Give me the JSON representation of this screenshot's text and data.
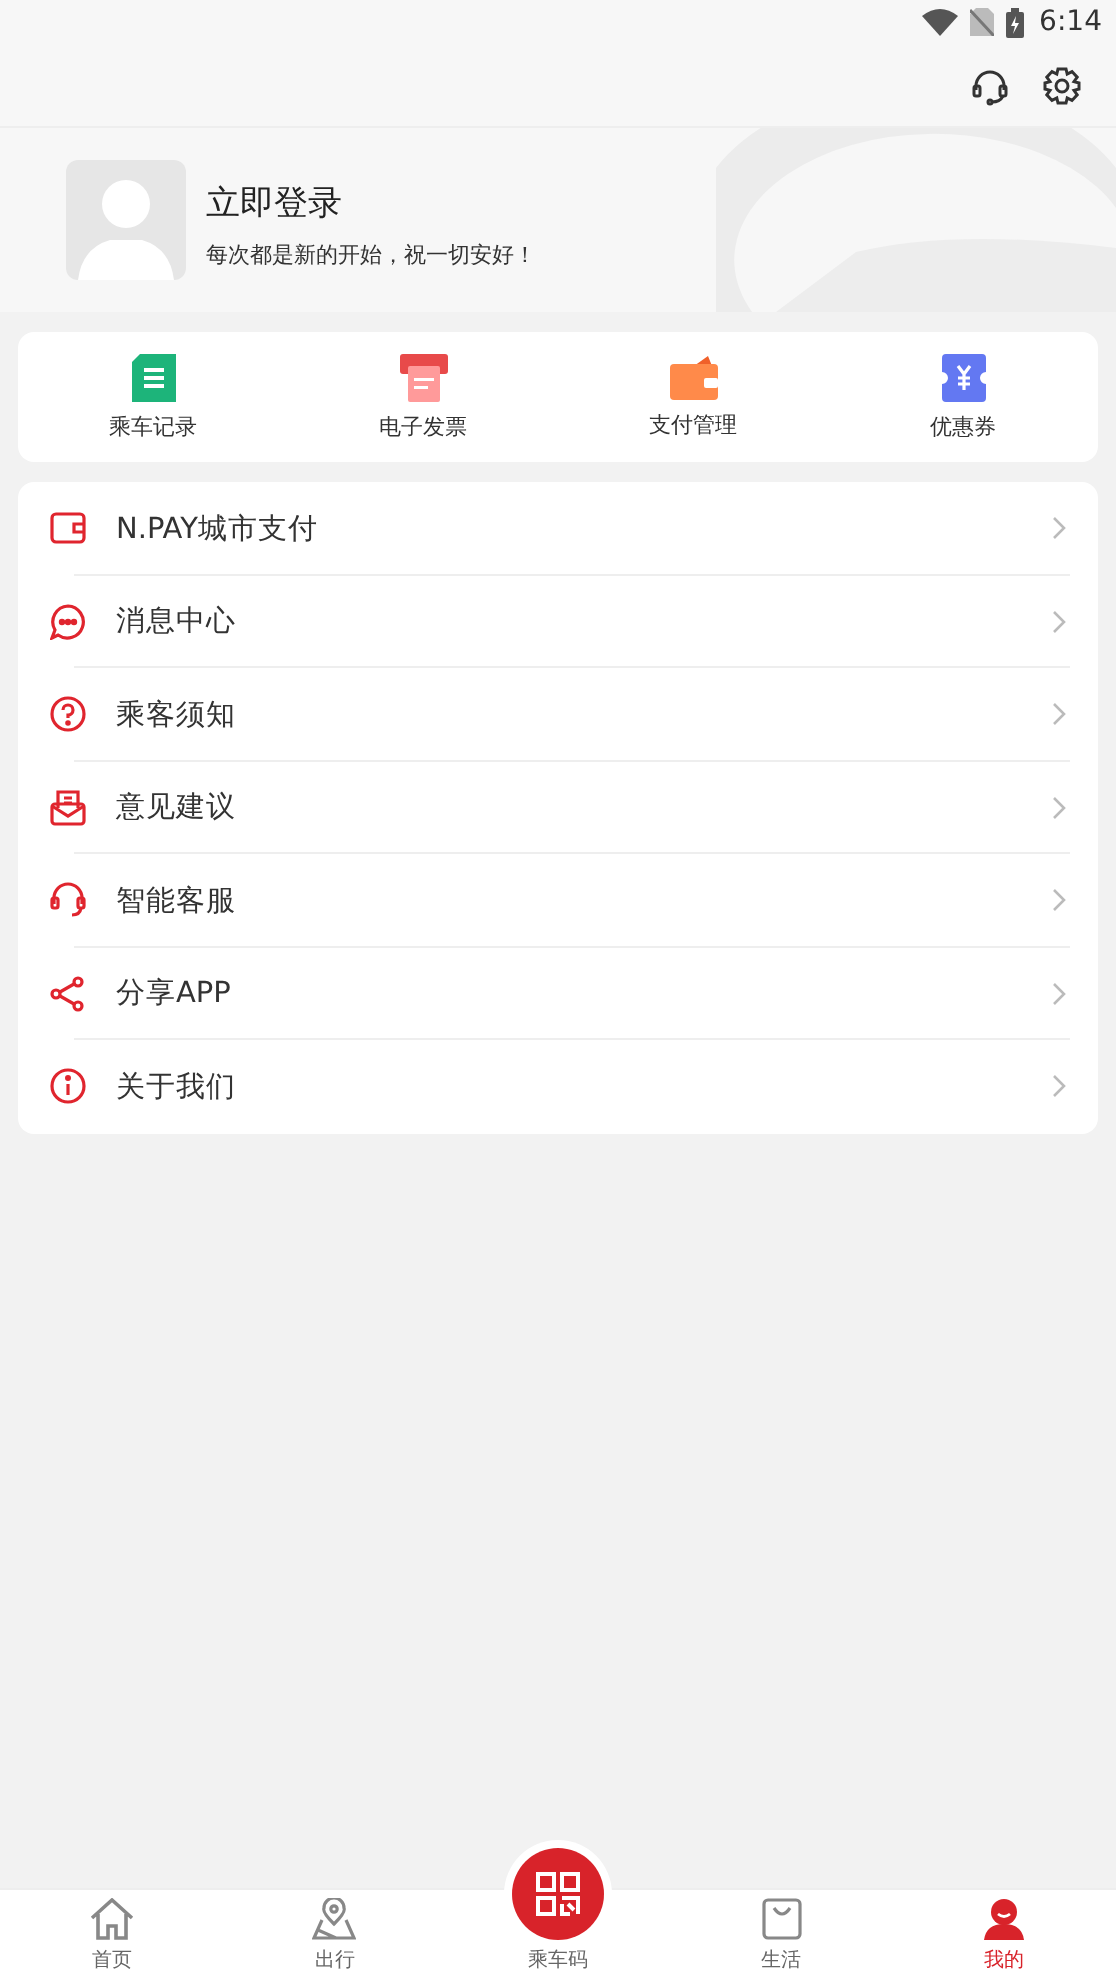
{
  "status_bar": {
    "time": "6:14"
  },
  "header": {
    "title": "立即登录",
    "subtitle": "每次都是新的开始，祝一切安好！"
  },
  "quick_actions": [
    {
      "kind": "records",
      "label": "乘车记录"
    },
    {
      "kind": "invoice",
      "label": "电子发票"
    },
    {
      "kind": "wallet",
      "label": "支付管理"
    },
    {
      "kind": "coupon",
      "label": "优惠券"
    }
  ],
  "menu": [
    {
      "kind": "wallet",
      "label": "N.PAY城市支付"
    },
    {
      "kind": "message",
      "label": "消息中心"
    },
    {
      "kind": "help",
      "label": "乘客须知"
    },
    {
      "kind": "mail",
      "label": "意见建议"
    },
    {
      "kind": "headset",
      "label": "智能客服"
    },
    {
      "kind": "share",
      "label": "分享APP"
    },
    {
      "kind": "info",
      "label": "关于我们"
    }
  ],
  "tab_bar": [
    {
      "kind": "home",
      "label": "首页",
      "selected": false
    },
    {
      "kind": "map",
      "label": "出行",
      "selected": false
    },
    {
      "kind": "qr",
      "label": "乘车码",
      "selected": false
    },
    {
      "kind": "bag",
      "label": "生活",
      "selected": false
    },
    {
      "kind": "me",
      "label": "我的",
      "selected": true
    }
  ]
}
